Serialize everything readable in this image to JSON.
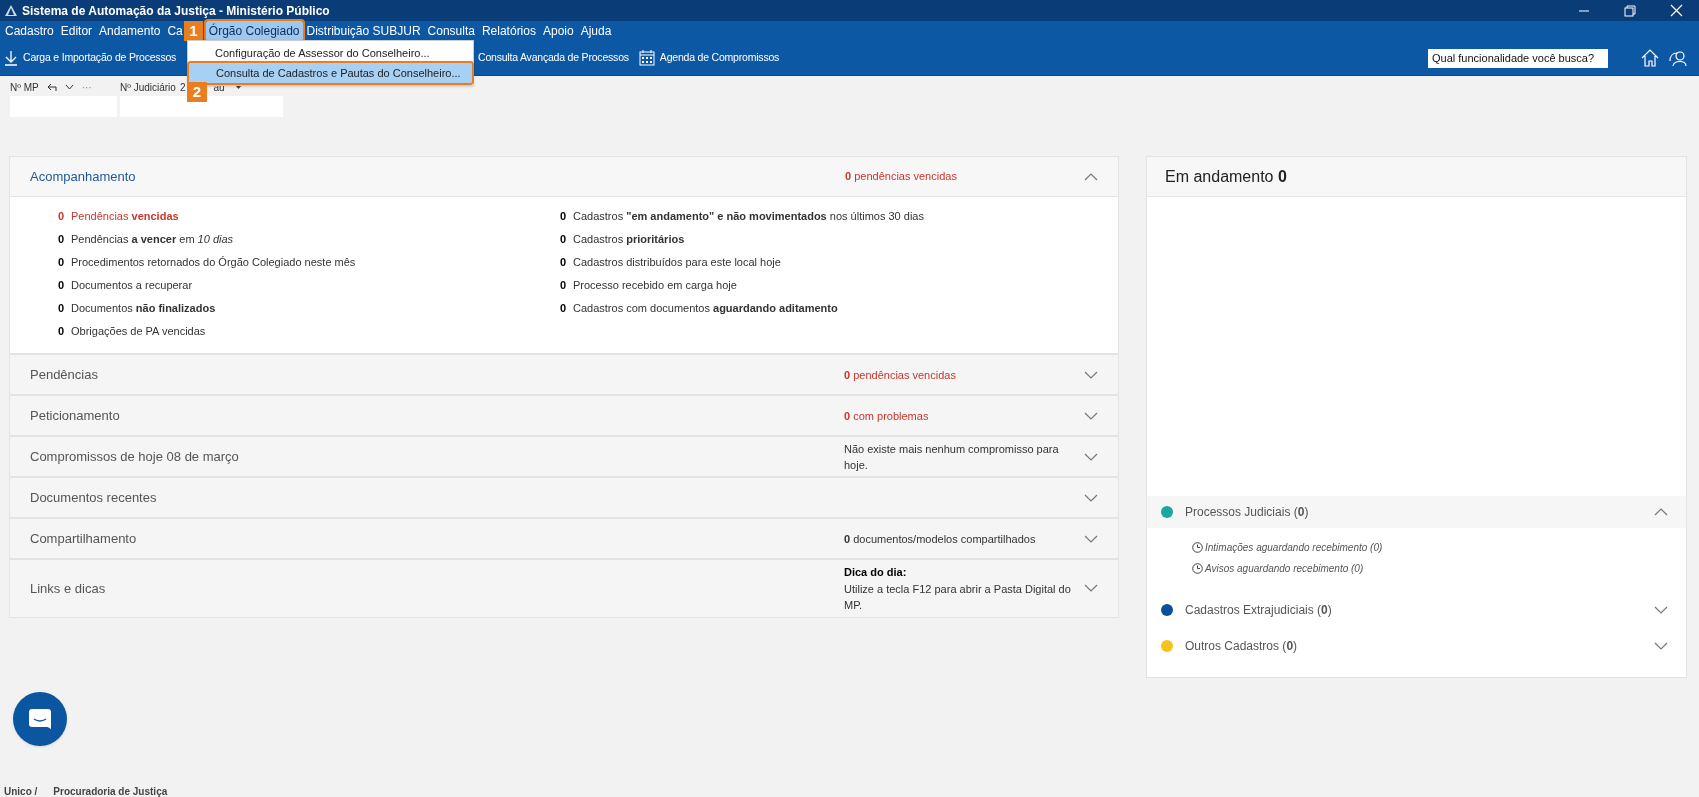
{
  "window": {
    "title": "Sistema de Automação da Justiça - Ministério Público"
  },
  "menu": [
    {
      "label": "Cadastro",
      "selected": false
    },
    {
      "label": "Editor",
      "selected": false
    },
    {
      "label": "Andamento",
      "selected": false
    },
    {
      "label": "Ca",
      "selected": false
    },
    {
      "label": "Órgão Colegiado",
      "selected": true
    },
    {
      "label": "Distribuição SUBJUR",
      "selected": false
    },
    {
      "label": "Consulta",
      "selected": false
    },
    {
      "label": "Relatórios",
      "selected": false
    },
    {
      "label": "Apoio",
      "selected": false
    },
    {
      "label": "Ajuda",
      "selected": false
    }
  ],
  "dropdown": [
    {
      "label": "Configuração de Assessor do Conselheiro...",
      "selected": false
    },
    {
      "label": "Consulta de Cadastros e Pautas do Conselheiro...",
      "selected": true
    }
  ],
  "step_badges": [
    "1",
    "2"
  ],
  "toolbar": [
    {
      "label": "Carga e Importação de Processos",
      "kind": "download"
    },
    {
      "label": "Consulta Avançada de Processos",
      "kind": "plain"
    },
    {
      "label": "Agenda de Compromissos",
      "kind": "calendar"
    }
  ],
  "search": {
    "placeholder": "Qual funcionalidade você busca?"
  },
  "fields": {
    "mp_label": "Nº MP",
    "more": "···",
    "judicial_label": "Nº Judiciário",
    "grade_parts": [
      "2",
      "au"
    ]
  },
  "acompanhamento": {
    "title": "Acompanhamento",
    "summary": "**0** pendências vencidas",
    "expanded": true,
    "left_items": [
      {
        "count": "0",
        "text": "Pendências **vencidas**",
        "alert": true
      },
      {
        "count": "0",
        "text": "Pendências **a vencer** em *10 dias*",
        "alert": false
      },
      {
        "count": "0",
        "text": "Procedimentos retornados do Órgão Colegiado neste mês",
        "alert": false
      },
      {
        "count": "0",
        "text": "Documentos a recuperar",
        "alert": false
      },
      {
        "count": "0",
        "text": "Documentos **não finalizados**",
        "alert": false
      },
      {
        "count": "0",
        "text": "Obrigações de PA vencidas",
        "alert": false
      }
    ],
    "right_items": [
      {
        "count": "0",
        "text": "Cadastros **\"em andamento\" e não movimentados** nos últimos 30 dias",
        "alert": false
      },
      {
        "count": "0",
        "text": "Cadastros **prioritários**",
        "alert": false
      },
      {
        "count": "0",
        "text": "Cadastros distribuídos para este local hoje",
        "alert": false
      },
      {
        "count": "0",
        "text": "Processo recebido em carga hoje",
        "alert": false
      },
      {
        "count": "0",
        "text": "Cadastros com documentos **aguardando aditamento**",
        "alert": false
      }
    ]
  },
  "sections": [
    {
      "title": "Pendências",
      "summary": "**0** pendências vencidas",
      "alert": true,
      "expanded": false
    },
    {
      "title": "Peticionamento",
      "summary": "**0** com problemas",
      "alert": true,
      "expanded": false
    },
    {
      "title": "Compromissos de hoje 08 de março",
      "summary": "Não existe mais nenhum compromisso para hoje.",
      "alert": false,
      "expanded": false
    },
    {
      "title": "Documentos recentes",
      "expanded": false
    },
    {
      "title": "Compartilhamento",
      "summary": "**0** documentos/modelos compartilhados",
      "alert": false,
      "expanded": false
    },
    {
      "title": "Links e dicas",
      "summary_title": "Dica do dia:",
      "summary": "Utilize a tecla F12 para abrir a Pasta Digital do MP.",
      "alert": false,
      "expanded": false
    }
  ],
  "in_progress": {
    "title": "Em andamento **0**",
    "categories": [
      {
        "label": "Processos Judiciais (**0**)",
        "color": "#1aa89a",
        "expanded": true,
        "children": [
          "Intimações aguardando recebimento (0)",
          "Avisos aguardando recebimento (0)"
        ]
      },
      {
        "label": "Cadastros Extrajudiciais (**0**)",
        "color": "#0b4f9c",
        "expanded": false
      },
      {
        "label": "Outros Cadastros (**0**)",
        "color": "#f7c21b",
        "expanded": false
      }
    ]
  },
  "status_bar": [
    "Unico /",
    "Procuradoria de Justiça"
  ]
}
